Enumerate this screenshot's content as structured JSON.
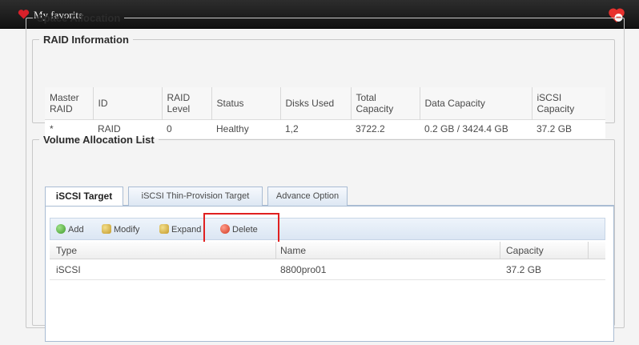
{
  "window": {
    "title": "My favorite",
    "close_icon": "close-icon"
  },
  "space_allocation": {
    "legend": "Space Allocation",
    "raid_information": {
      "legend": "RAID Information",
      "columns": [
        "Master RAID",
        "ID",
        "RAID Level",
        "Status",
        "Disks Used",
        "Total Capacity",
        "Data Capacity",
        "iSCSI Capacity"
      ],
      "rows": [
        [
          "*",
          "RAID",
          "0",
          "Healthy",
          "1,2",
          "3722.2",
          "0.2 GB / 3424.4 GB",
          "37.2 GB"
        ]
      ]
    },
    "volume_allocation": {
      "legend": "Volume Allocation List",
      "tabs": [
        {
          "label": "iSCSI Target",
          "active": true
        },
        {
          "label": "iSCSI Thin-Provision Target",
          "active": false
        },
        {
          "label": "Advance Option",
          "active": false
        }
      ],
      "toolbar": {
        "add": "Add",
        "modify": "Modify",
        "expand": "Expand",
        "delete": "Delete"
      },
      "list": {
        "columns": [
          "Type",
          "Name",
          "Capacity"
        ],
        "rows": [
          [
            "iSCSI",
            "8800pro01",
            "37.2 GB"
          ]
        ]
      }
    }
  },
  "colors": {
    "titlebar": "#1a1a1a",
    "highlight": "#e02020",
    "tab_border": "#a9bcd3"
  }
}
